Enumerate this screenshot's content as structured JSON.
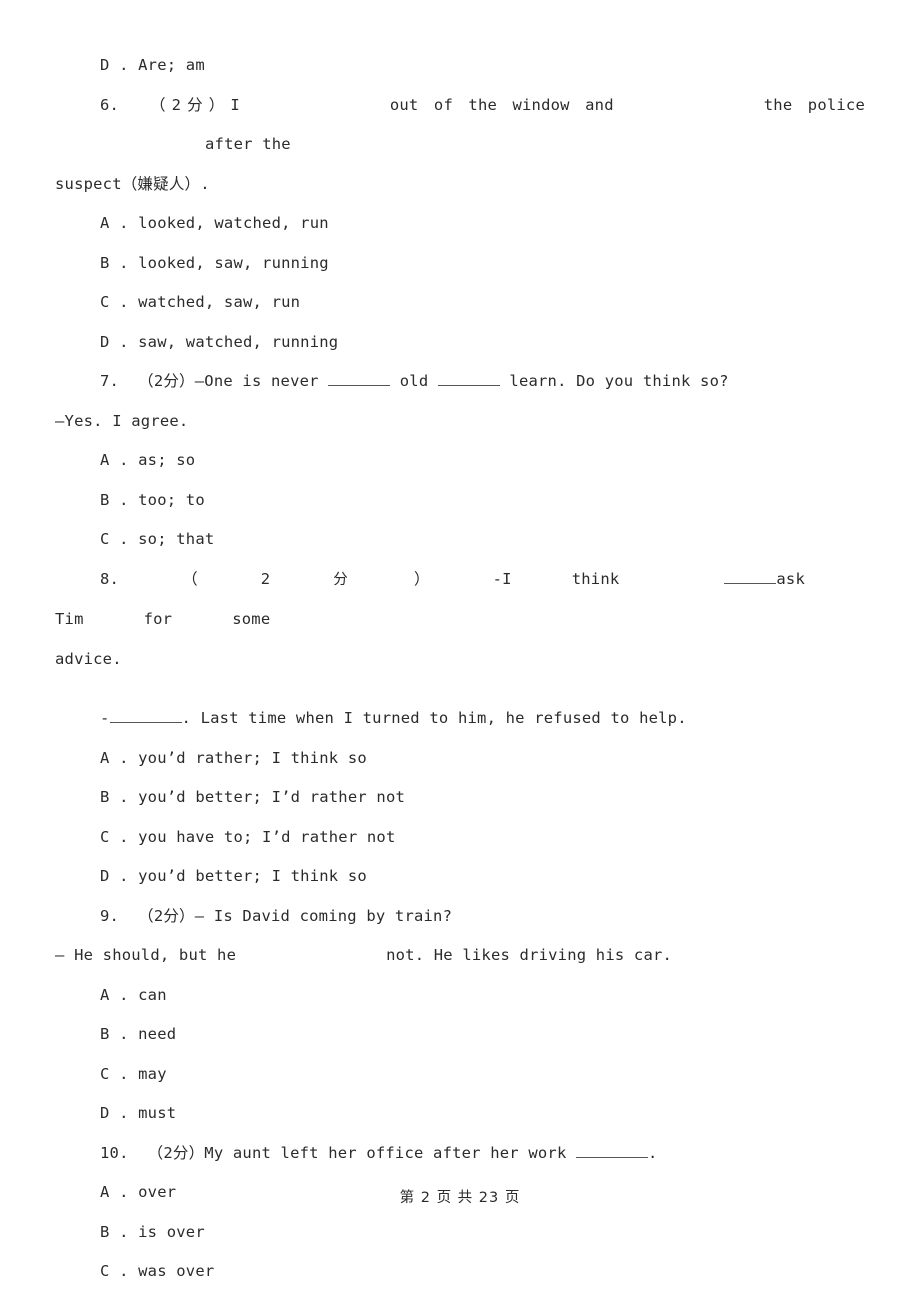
{
  "document": {
    "page_label": "第 2 页 共 23 页",
    "page_number": "2",
    "total_pages": "23",
    "text_color": "#2b2b2b",
    "background_color": "#ffffff"
  },
  "carryover_option": {
    "label": "D . Are; am"
  },
  "questions": [
    {
      "number": "6",
      "marks": "（2分）",
      "stem_part_1": "6.  （2分）I",
      "stem_part_2": "out of the window and",
      "stem_part_3": "the police",
      "stem_part_4": "after the",
      "stem_part_5": "suspect（嫌疑人）.",
      "options": [
        "A . looked, watched, run",
        "B . looked, saw, running",
        "C . watched, saw, run",
        "D . saw, watched, running"
      ]
    },
    {
      "number": "7",
      "stem_part_1": "7.  （2分）—One is never ",
      "stem_part_2": " old ",
      "stem_part_3": " learn. Do you think so?",
      "stem_line_2": "—Yes. I agree.",
      "options": [
        "A . as; so",
        "B . too; to",
        "C . so; that"
      ]
    },
    {
      "number": "8",
      "stem_tokens": [
        "8.",
        "（",
        "2",
        "分",
        "）",
        "-I",
        "think",
        "ask",
        "Tim",
        "for",
        "some"
      ],
      "stem_part_1": "8.",
      "stem_part_2": "（",
      "stem_part_3": "2",
      "stem_part_4": "分",
      "stem_part_5": "）",
      "stem_part_6": "-I",
      "stem_part_7": "think",
      "stem_part_8": "ask",
      "stem_part_9": "Tim",
      "stem_part_10": "for",
      "stem_part_11": "some",
      "stem_line_2": "advice.",
      "reply_prefix": "-",
      "reply_rest": ". Last time when I turned to him, he refused to help.",
      "options": [
        "A . you’d rather; I think so",
        "B . you’d better; I’d rather not",
        "C . you have to; I’d rather not",
        "D . you’d better; I think so"
      ]
    },
    {
      "number": "9",
      "stem_line_1": "9.  （2分）— Is David coming by train?",
      "stem_line_2_part_1": "— He should, but he",
      "stem_line_2_part_2": "not. He likes driving his car.",
      "options": [
        "A . can",
        "B . need",
        "C . may",
        "D . must"
      ]
    },
    {
      "number": "10",
      "stem_part_1": "10.  （2分）My aunt left her office after her work ",
      "stem_part_2": ".",
      "options": [
        "A . over",
        "B . is over",
        "C . was over"
      ]
    }
  ]
}
